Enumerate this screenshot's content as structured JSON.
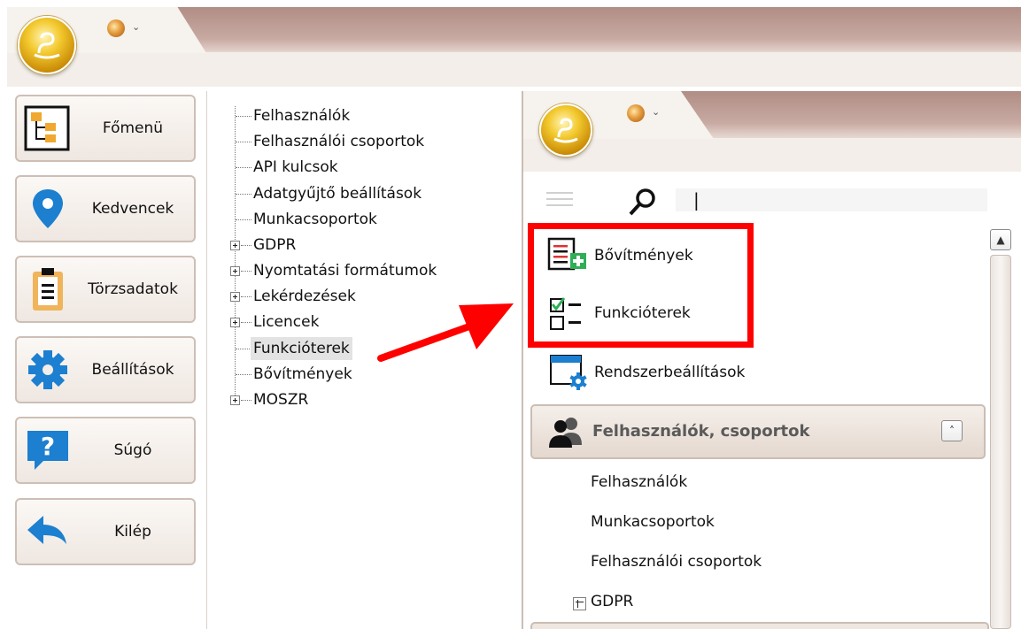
{
  "nav": {
    "items": [
      {
        "label": "Főmenü",
        "icon": "main-menu-icon"
      },
      {
        "label": "Kedvencek",
        "icon": "location-pin-icon"
      },
      {
        "label": "Törzsadatok",
        "icon": "clipboard-icon"
      },
      {
        "label": "Beállítások",
        "icon": "gear-icon"
      },
      {
        "label": "Súgó",
        "icon": "help-icon"
      },
      {
        "label": "Kilép",
        "icon": "exit-arrow-icon"
      }
    ]
  },
  "tree": {
    "items": [
      {
        "label": "Felhasználók",
        "expandable": false
      },
      {
        "label": "Felhasználói csoportok",
        "expandable": false
      },
      {
        "label": "API kulcsok",
        "expandable": false
      },
      {
        "label": "Adatgyűjtő beállítások",
        "expandable": false
      },
      {
        "label": "Munkacsoportok",
        "expandable": false
      },
      {
        "label": "GDPR",
        "expandable": true
      },
      {
        "label": "Nyomtatási formátumok",
        "expandable": true
      },
      {
        "label": "Lekérdezések",
        "expandable": true
      },
      {
        "label": "Licencek",
        "expandable": true
      },
      {
        "label": "Funkcióterek",
        "expandable": false,
        "selected": true
      },
      {
        "label": "Bővítmények",
        "expandable": false
      },
      {
        "label": "MOSZR",
        "expandable": true
      }
    ]
  },
  "panel": {
    "search": {
      "value": "|"
    },
    "items": [
      {
        "label": "Bővítmények",
        "icon": "extensions-icon"
      },
      {
        "label": "Funkcióterek",
        "icon": "function-spaces-icon"
      },
      {
        "label": "Rendszerbeállítások",
        "icon": "system-settings-icon"
      }
    ],
    "group": {
      "title": "Felhasználók, csoportok",
      "icon": "users-group-icon",
      "items": [
        {
          "label": "Felhasználók"
        },
        {
          "label": "Munkacsoportok"
        },
        {
          "label": "Felhasználói csoportok"
        },
        {
          "label": "GDPR",
          "expandable": true
        }
      ]
    }
  },
  "colors": {
    "highlight": "#ff0000",
    "titlebar": "#c8aaa2"
  }
}
